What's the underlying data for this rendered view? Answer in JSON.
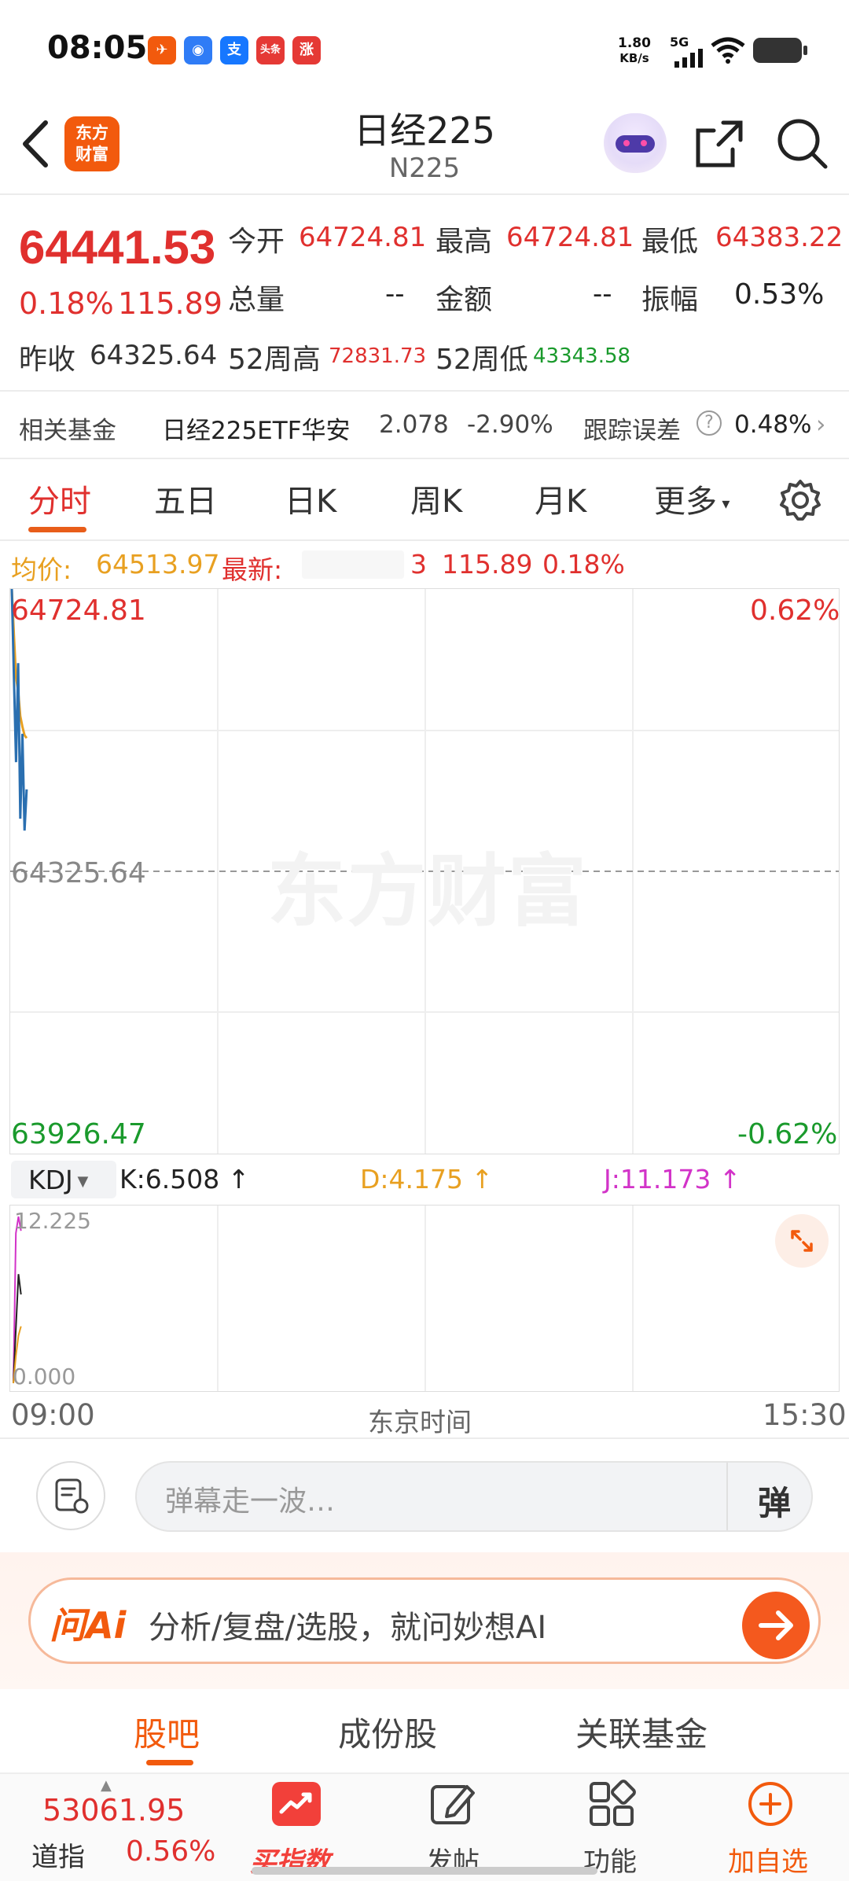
{
  "status_bar": {
    "time": "08:05",
    "net_speed": "1.80",
    "net_unit": "KB/s",
    "network": "5G",
    "app_icons": [
      "bird-app-icon",
      "cloud-app-icon",
      "alipay-icon",
      "toutiao-icon",
      "zhang-icon"
    ],
    "toutiao_text": "头条",
    "zhang_text": "涨",
    "alipay_text": "支"
  },
  "header": {
    "logo_line1": "东方",
    "logo_line2": "财富",
    "title": "日经225",
    "code": "N225"
  },
  "quote": {
    "price": "64441.53",
    "change_pct": "0.18%",
    "change_amt": "115.89",
    "prev_close_label": "昨收",
    "prev_close": "64325.64",
    "open_label": "今开",
    "open": "64724.81",
    "high_label": "最高",
    "high": "64724.81",
    "low_label": "最低",
    "low": "64383.22",
    "volume_label": "总量",
    "volume": "--",
    "amount_label": "金额",
    "amount": "--",
    "amplitude_label": "振幅",
    "amplitude": "0.53%",
    "week52_high_label": "52周高",
    "week52_high": "72831.73",
    "week52_low_label": "52周低",
    "week52_low": "43343.58"
  },
  "fund": {
    "label": "相关基金",
    "name": "日经225ETF华安",
    "price": "2.078",
    "change": "-2.90%",
    "tracking_label": "跟踪误差",
    "tracking_value": "0.48%"
  },
  "tabs": [
    {
      "label": "分时",
      "active": true
    },
    {
      "label": "五日"
    },
    {
      "label": "日K"
    },
    {
      "label": "周K"
    },
    {
      "label": "月K"
    },
    {
      "label": "更多"
    }
  ],
  "avg_bar": {
    "avg_label": "均价:",
    "avg_value": "64513.97",
    "latest_label": "最新:",
    "latest_value": "3",
    "latest_change": "115.89",
    "latest_pct": "0.18%"
  },
  "chart_data": {
    "type": "line",
    "y_top_label": "64724.81",
    "y_mid_label": "64325.64",
    "y_bottom_label": "63926.47",
    "pct_top": "0.62%",
    "pct_bottom": "-0.62%",
    "ylim": [
      63926.47,
      64724.81
    ],
    "reference": 64325.64,
    "watermark": "东方财富",
    "series": [
      {
        "name": "price",
        "color": "#2a6fb0",
        "x": [
          0,
          1,
          2,
          3,
          4,
          5,
          6,
          7
        ],
        "values": [
          64724.81,
          64600,
          64480,
          64620,
          64400,
          64520,
          64383.22,
          64441.53
        ]
      },
      {
        "name": "avg",
        "color": "#e8a021",
        "x": [
          0,
          1,
          2,
          3,
          4,
          5,
          6,
          7
        ],
        "values": [
          64724.81,
          64660,
          64600,
          64580,
          64545,
          64530,
          64518,
          64513.97
        ]
      }
    ],
    "x_start": "09:00",
    "x_mid": "东京时间",
    "x_end": "15:30",
    "x_total": 390
  },
  "kdj": {
    "selector": "KDJ",
    "k": "K:6.508",
    "d": "D:4.175",
    "j": "J:11.173",
    "arrow": "↑",
    "y_top": "12.225",
    "y_bottom": "0.000",
    "ylim": [
      0,
      12.225
    ],
    "series": [
      {
        "name": "K",
        "color": "#222222",
        "values": [
          0,
          4,
          8,
          6.508
        ]
      },
      {
        "name": "D",
        "color": "#e8a021",
        "values": [
          0,
          2,
          3.5,
          4.175
        ]
      },
      {
        "name": "J",
        "color": "#d233c8",
        "values": [
          0,
          11,
          12.225,
          11.173
        ]
      }
    ]
  },
  "danmaku": {
    "placeholder": "弹幕走一波…",
    "send_label": "弹"
  },
  "ai": {
    "logo": "问Ai",
    "text": "分析/复盘/选股，就问妙想AI"
  },
  "sub_tabs": [
    {
      "label": "股吧",
      "active": true
    },
    {
      "label": "成份股"
    },
    {
      "label": "关联基金"
    }
  ],
  "bottom_bar": {
    "ticker_value": "53061.95",
    "ticker_name": "道指",
    "ticker_pct": "0.56%",
    "buy_label": "买指数",
    "post_label": "发帖",
    "func_label": "功能",
    "add_label": "加自选"
  }
}
